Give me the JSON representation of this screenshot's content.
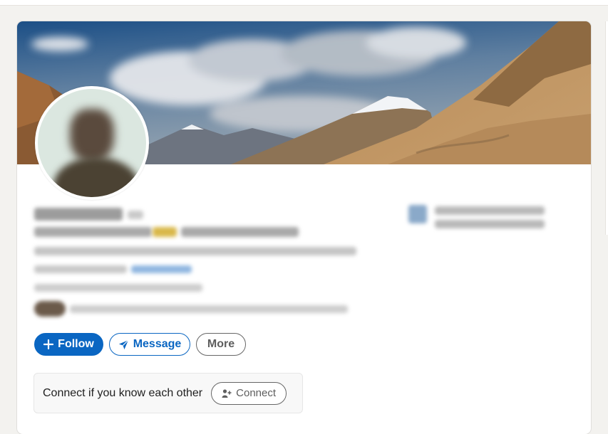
{
  "actions": {
    "follow_label": "Follow",
    "message_label": "Message",
    "more_label": "More"
  },
  "connect_prompt": {
    "text": "Connect if you know each other",
    "button_label": "Connect"
  },
  "icons": {
    "follow": "plus-icon",
    "message": "paper-plane-icon",
    "connect": "add-person-icon"
  },
  "colors": {
    "accent": "#0a66c2",
    "page_background": "#f3f2ef",
    "card_background": "#ffffff"
  }
}
